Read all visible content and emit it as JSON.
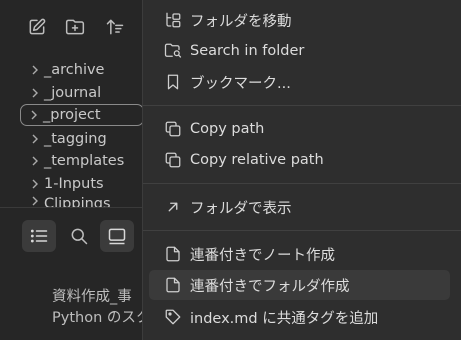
{
  "tree": {
    "items": [
      {
        "label": "_archive"
      },
      {
        "label": "_journal"
      },
      {
        "label": "_project"
      },
      {
        "label": "_tagging"
      },
      {
        "label": "_templates"
      },
      {
        "label": "1-Inputs"
      },
      {
        "label": "Clippings"
      }
    ]
  },
  "preview": {
    "line1": "資料作成_事",
    "line2": "Python のスク"
  },
  "menu": {
    "items": [
      {
        "label": "フォルダを移動",
        "icon": "move-folder-icon"
      },
      {
        "label": "Search in folder",
        "icon": "folder-search-icon"
      },
      {
        "label": "ブックマーク...",
        "icon": "bookmark-icon"
      },
      {
        "label": "Copy path",
        "icon": "copy-icon"
      },
      {
        "label": "Copy relative path",
        "icon": "copy-icon"
      },
      {
        "label": "フォルダで表示",
        "icon": "arrow-up-right-icon"
      },
      {
        "label": "連番付きでノート作成",
        "icon": "file-icon"
      },
      {
        "label": "連番付きでフォルダ作成",
        "icon": "file-icon"
      },
      {
        "label": "index.md に共通タグを追加",
        "icon": "tag-icon"
      }
    ]
  }
}
